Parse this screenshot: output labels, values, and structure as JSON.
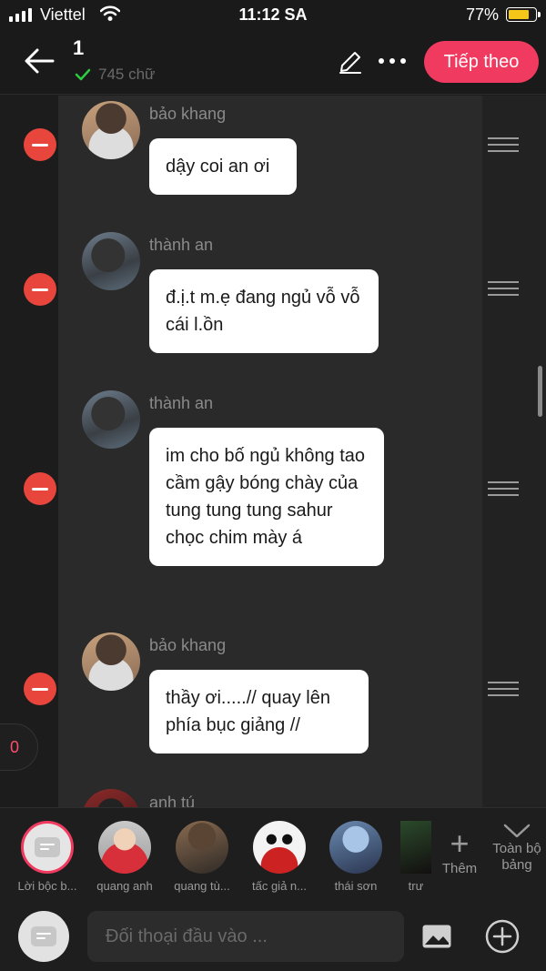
{
  "status": {
    "carrier": "Viettel",
    "time": "11:12 SA",
    "battery_pct": "77%",
    "battery_level": 0.77
  },
  "header": {
    "title": "1",
    "word_count": "745 chữ",
    "next_label": "Tiếp theo"
  },
  "messages": [
    {
      "name": "bảo khang",
      "text": "dậy coi an ơi"
    },
    {
      "name": "thành an",
      "text": "đ.ị.t m.ẹ đang ngủ vỗ vỗ cái l.ồn"
    },
    {
      "name": "thành an",
      "text": "im cho bố ngủ không tao cầm gậy bóng chày của tung tung tung sahur chọc chim mày á"
    },
    {
      "name": "bảo khang",
      "text": "thầy ơi.....// quay lên phía bục giảng //"
    },
    {
      "name": "anh tú"
    }
  ],
  "side_counter": "0",
  "tray": {
    "characters": [
      {
        "label": "Lời bộc b...",
        "icon": "narration-icon"
      },
      {
        "label": "quang anh"
      },
      {
        "label": "quang tù..."
      },
      {
        "label": "tấc giả n..."
      },
      {
        "label": "thái sơn"
      },
      {
        "label": "trư"
      }
    ],
    "add_label": "Thêm",
    "all_board_label": "Toàn bộ bảng"
  },
  "composer": {
    "placeholder": "Đối thoại đầu vào ..."
  },
  "colors": {
    "accent": "#f03a5f",
    "delete": "#e8453c",
    "battery": "#f5c518",
    "check": "#2ecc40"
  }
}
